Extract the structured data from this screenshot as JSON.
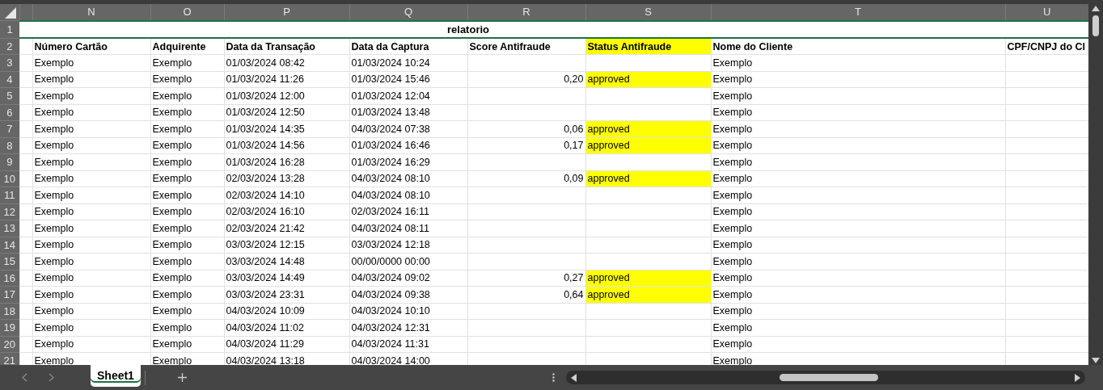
{
  "columns": [
    "N",
    "O",
    "P",
    "Q",
    "R",
    "S",
    "T",
    "U"
  ],
  "title_row": {
    "number": "1",
    "text": "relatorio"
  },
  "header_row": {
    "number": "2",
    "cells": [
      {
        "text": "Número Cartão",
        "highlighted": false
      },
      {
        "text": "Adquirente",
        "highlighted": false
      },
      {
        "text": "Data da Transação",
        "highlighted": false
      },
      {
        "text": "Data da Captura",
        "highlighted": false
      },
      {
        "text": "Score Antifraude",
        "highlighted": false
      },
      {
        "text": "Status Antifraude",
        "highlighted": true
      },
      {
        "text": "Nome do Cliente",
        "highlighted": false
      },
      {
        "text": "CPF/CNPJ do Cl",
        "highlighted": false
      }
    ]
  },
  "rows": [
    {
      "number": "3",
      "card": "Exemplo",
      "acquirer": "Exemplo",
      "transaction_date": "01/03/2024 08:42",
      "capture_date": "01/03/2024 10:24",
      "client": "Exemplo",
      "highlighted": false
    },
    {
      "number": "4",
      "card": "Exemplo",
      "acquirer": "Exemplo",
      "transaction_date": "01/03/2024 11:26",
      "capture_date": "01/03/2024 15:46",
      "score": "0,20",
      "status": "approved",
      "client": "Exemplo",
      "highlighted": true
    },
    {
      "number": "5",
      "card": "Exemplo",
      "acquirer": "Exemplo",
      "transaction_date": "01/03/2024 12:00",
      "capture_date": "01/03/2024 12:04",
      "client": "Exemplo",
      "highlighted": false
    },
    {
      "number": "6",
      "card": "Exemplo",
      "acquirer": "Exemplo",
      "transaction_date": "01/03/2024 12:50",
      "capture_date": "01/03/2024 13:48",
      "client": "Exemplo",
      "highlighted": false
    },
    {
      "number": "7",
      "card": "Exemplo",
      "acquirer": "Exemplo",
      "transaction_date": "01/03/2024 14:35",
      "capture_date": "04/03/2024 07:38",
      "score": "0,06",
      "status": "approved",
      "client": "Exemplo",
      "highlighted": true
    },
    {
      "number": "8",
      "card": "Exemplo",
      "acquirer": "Exemplo",
      "transaction_date": "01/03/2024 14:56",
      "capture_date": "01/03/2024 16:46",
      "score": "0,17",
      "status": "approved",
      "client": "Exemplo",
      "highlighted": true
    },
    {
      "number": "9",
      "card": "Exemplo",
      "acquirer": "Exemplo",
      "transaction_date": "01/03/2024 16:28",
      "capture_date": "01/03/2024 16:29",
      "client": "Exemplo",
      "highlighted": false
    },
    {
      "number": "10",
      "card": "Exemplo",
      "acquirer": "Exemplo",
      "transaction_date": "02/03/2024 13:28",
      "capture_date": "04/03/2024 08:10",
      "score": "0,09",
      "status": "approved",
      "client": "Exemplo",
      "highlighted": true
    },
    {
      "number": "11",
      "card": "Exemplo",
      "acquirer": "Exemplo",
      "transaction_date": "02/03/2024 14:10",
      "capture_date": "04/03/2024 08:10",
      "client": "Exemplo",
      "highlighted": false
    },
    {
      "number": "12",
      "card": "Exemplo",
      "acquirer": "Exemplo",
      "transaction_date": "02/03/2024 16:10",
      "capture_date": "02/03/2024 16:11",
      "client": "Exemplo",
      "highlighted": false
    },
    {
      "number": "13",
      "card": "Exemplo",
      "acquirer": "Exemplo",
      "transaction_date": "02/03/2024 21:42",
      "capture_date": "04/03/2024 08:11",
      "client": "Exemplo",
      "highlighted": false
    },
    {
      "number": "14",
      "card": "Exemplo",
      "acquirer": "Exemplo",
      "transaction_date": "03/03/2024 12:15",
      "capture_date": "03/03/2024 12:18",
      "client": "Exemplo",
      "highlighted": false
    },
    {
      "number": "15",
      "card": "Exemplo",
      "acquirer": "Exemplo",
      "transaction_date": "03/03/2024 14:48",
      "capture_date": "00/00/0000 00:00",
      "client": "Exemplo",
      "highlighted": false
    },
    {
      "number": "16",
      "card": "Exemplo",
      "acquirer": "Exemplo",
      "transaction_date": "03/03/2024 14:49",
      "capture_date": "04/03/2024 09:02",
      "score": "0,27",
      "status": "approved",
      "client": "Exemplo",
      "highlighted": true
    },
    {
      "number": "17",
      "card": "Exemplo",
      "acquirer": "Exemplo",
      "transaction_date": "03/03/2024 23:31",
      "capture_date": "04/03/2024 09:38",
      "score": "0,64",
      "status": "approved",
      "client": "Exemplo",
      "highlighted": true
    },
    {
      "number": "18",
      "card": "Exemplo",
      "acquirer": "Exemplo",
      "transaction_date": "04/03/2024 10:09",
      "capture_date": "04/03/2024 10:10",
      "client": "Exemplo",
      "highlighted": false
    },
    {
      "number": "19",
      "card": "Exemplo",
      "acquirer": "Exemplo",
      "transaction_date": "04/03/2024 11:02",
      "capture_date": "04/03/2024 12:31",
      "client": "Exemplo",
      "highlighted": false
    },
    {
      "number": "20",
      "card": "Exemplo",
      "acquirer": "Exemplo",
      "transaction_date": "04/03/2024 11:29",
      "capture_date": "04/03/2024 11:31",
      "client": "Exemplo",
      "highlighted": false
    },
    {
      "number": "21",
      "card": "Exemplo",
      "acquirer": "Exemplo",
      "transaction_date": "04/03/2024 13:18",
      "capture_date": "04/03/2024 14:00",
      "client": "Exemplo",
      "highlighted": false
    }
  ],
  "sheet_tabs": [
    {
      "label": "Sheet1",
      "selected": true
    }
  ]
}
